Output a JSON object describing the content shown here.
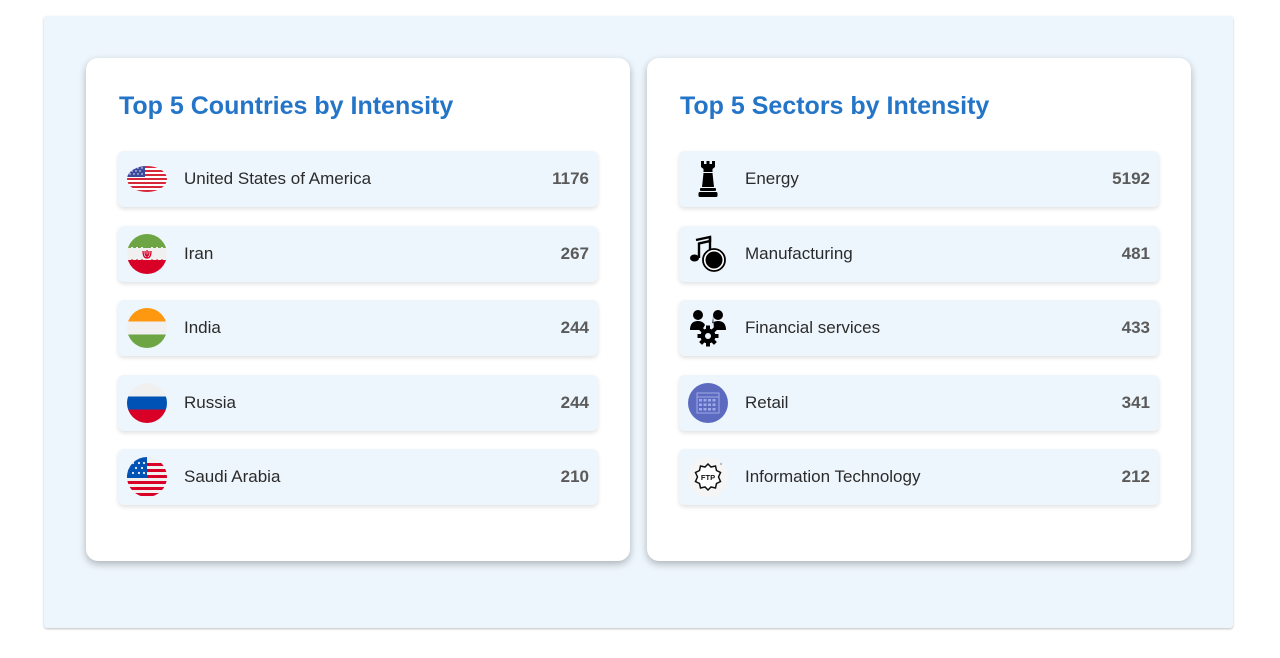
{
  "countries_panel": {
    "title": "Top 5 Countries by Intensity",
    "items": [
      {
        "name": "United States of America",
        "value": "1176",
        "icon": "us-flag-icon"
      },
      {
        "name": "Iran",
        "value": "267",
        "icon": "iran-flag-icon"
      },
      {
        "name": "India",
        "value": "244",
        "icon": "india-flag-icon"
      },
      {
        "name": "Russia",
        "value": "244",
        "icon": "russia-flag-icon"
      },
      {
        "name": "Saudi Arabia",
        "value": "210",
        "icon": "us-flag-round-icon"
      }
    ]
  },
  "sectors_panel": {
    "title": "Top 5 Sectors by Intensity",
    "items": [
      {
        "name": "Energy",
        "value": "5192",
        "icon": "chess-rook-icon"
      },
      {
        "name": "Manufacturing",
        "value": "481",
        "icon": "music-note-icon"
      },
      {
        "name": "Financial services",
        "value": "433",
        "icon": "people-gear-icon"
      },
      {
        "name": "Retail",
        "value": "341",
        "icon": "calendar-circle-icon"
      },
      {
        "name": "Information Technology",
        "value": "212",
        "icon": "ftp-badge-icon"
      }
    ]
  },
  "colors": {
    "title": "#2475c8",
    "panel_background": "#eef6fd",
    "card_background": "#ffffff",
    "value_text": "#5a5a5a"
  }
}
